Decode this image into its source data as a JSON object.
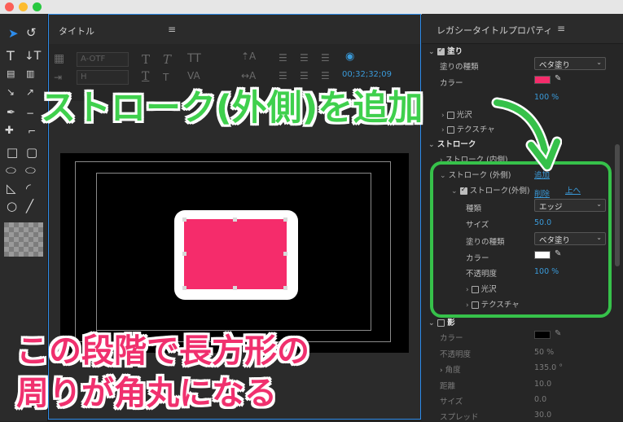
{
  "title_panel": {
    "tab_label": "タイトル",
    "font_family": "A-OTF",
    "font_style": "H",
    "timecode": "00;32;32;09"
  },
  "props_panel": {
    "tab_label": "レガシータイトルプロパティ",
    "rows": {
      "fill_header": "塗り",
      "fill_type_label": "塗りの種類",
      "fill_type_value": "ベタ塗り",
      "color_label": "カラー",
      "opacity_value": "100 %",
      "sheen_label": "光沢",
      "texture_label": "テクスチャ",
      "stroke_header": "ストローク",
      "inner_stroke_label": "ストローク (内側)",
      "inner_stroke_add": "追加",
      "outer_stroke_label": "ストローク (外側)",
      "outer_stroke_add": "追加",
      "outer_item_label": "ストローク(外側)",
      "delete_link": "削除",
      "up_link": "上へ",
      "type_label": "種類",
      "type_value": "エッジ",
      "size_label": "サイズ",
      "size_value": "50.0",
      "fill_type2_label": "塗りの種類",
      "fill_type2_value": "ベタ塗り",
      "color2_label": "カラー",
      "opacity2_label": "不透明度",
      "opacity2_value": "100 %",
      "sheen2_label": "光沢",
      "texture2_label": "テクスチャ",
      "shadow_header": "影",
      "shadow_color_label": "カラー",
      "shadow_opacity_label": "不透明度",
      "shadow_opacity_value": "50 %",
      "shadow_angle_label": "角度",
      "shadow_angle_value": "135.0 °",
      "shadow_distance_label": "距離",
      "shadow_distance_value": "10.0",
      "shadow_size_label": "サイズ",
      "shadow_size_value": "0.0",
      "shadow_spread_label": "スプレッド",
      "shadow_spread_value": "30.0"
    }
  },
  "colors": {
    "accent_blue": "#3a9ad9",
    "fill_pink": "#f52c6b",
    "stroke_white": "#ffffff",
    "highlight_green": "#36c14a",
    "caption_pink": "#f0306e"
  },
  "annotations": {
    "top_caption": "ストローク(外側)を追加",
    "bottom_caption_line1": "この段階で長方形の",
    "bottom_caption_line2": "周りが角丸になる"
  }
}
